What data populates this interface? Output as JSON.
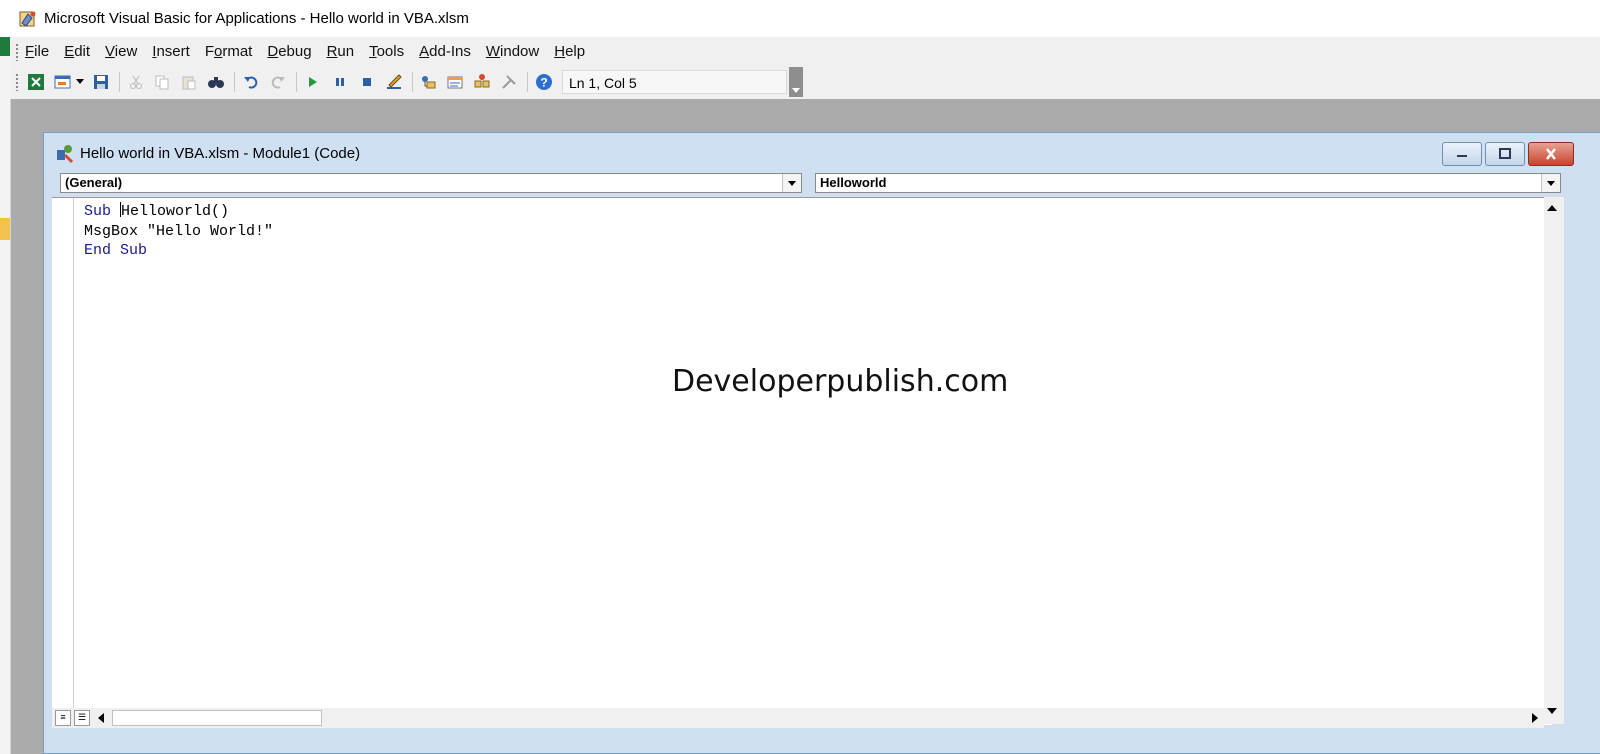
{
  "app": {
    "title": "Microsoft Visual Basic for Applications - Hello world in VBA.xlsm"
  },
  "menu": {
    "items": [
      {
        "pre": "",
        "key": "F",
        "post": "ile"
      },
      {
        "pre": "",
        "key": "E",
        "post": "dit"
      },
      {
        "pre": "",
        "key": "V",
        "post": "iew"
      },
      {
        "pre": "",
        "key": "I",
        "post": "nsert"
      },
      {
        "pre": "F",
        "key": "o",
        "post": "rmat"
      },
      {
        "pre": "",
        "key": "D",
        "post": "ebug"
      },
      {
        "pre": "",
        "key": "R",
        "post": "un"
      },
      {
        "pre": "",
        "key": "T",
        "post": "ools"
      },
      {
        "pre": "",
        "key": "A",
        "post": "dd-Ins"
      },
      {
        "pre": "",
        "key": "W",
        "post": "indow"
      },
      {
        "pre": "",
        "key": "H",
        "post": "elp"
      }
    ]
  },
  "toolbar": {
    "position": "Ln 1, Col 5",
    "icons": [
      "view-excel-icon",
      "insert-userform-icon",
      "save-icon",
      "cut-icon",
      "copy-icon",
      "paste-icon",
      "find-icon",
      "undo-icon",
      "redo-icon",
      "run-icon",
      "break-icon",
      "reset-icon",
      "design-mode-icon",
      "project-explorer-icon",
      "properties-window-icon",
      "object-browser-icon",
      "toolbox-icon",
      "help-icon"
    ]
  },
  "code_window": {
    "title": "Hello world in VBA.xlsm - Module1 (Code)",
    "object_combo": "(General)",
    "procedure_combo": "Helloworld",
    "code": {
      "line1_kw": "Sub",
      "line1_before_caret": " ",
      "line1_after_caret": "Helloworld()",
      "line2": "MsgBox \"Hello World!\"",
      "line3_kw": "End Sub"
    }
  },
  "watermark": "Developerpublish.com",
  "colors": {
    "keyword": "#1a1a8c",
    "workspace": "#ababab",
    "titlebar_active": "#cfe0f2",
    "close_button": "#c9442e"
  }
}
